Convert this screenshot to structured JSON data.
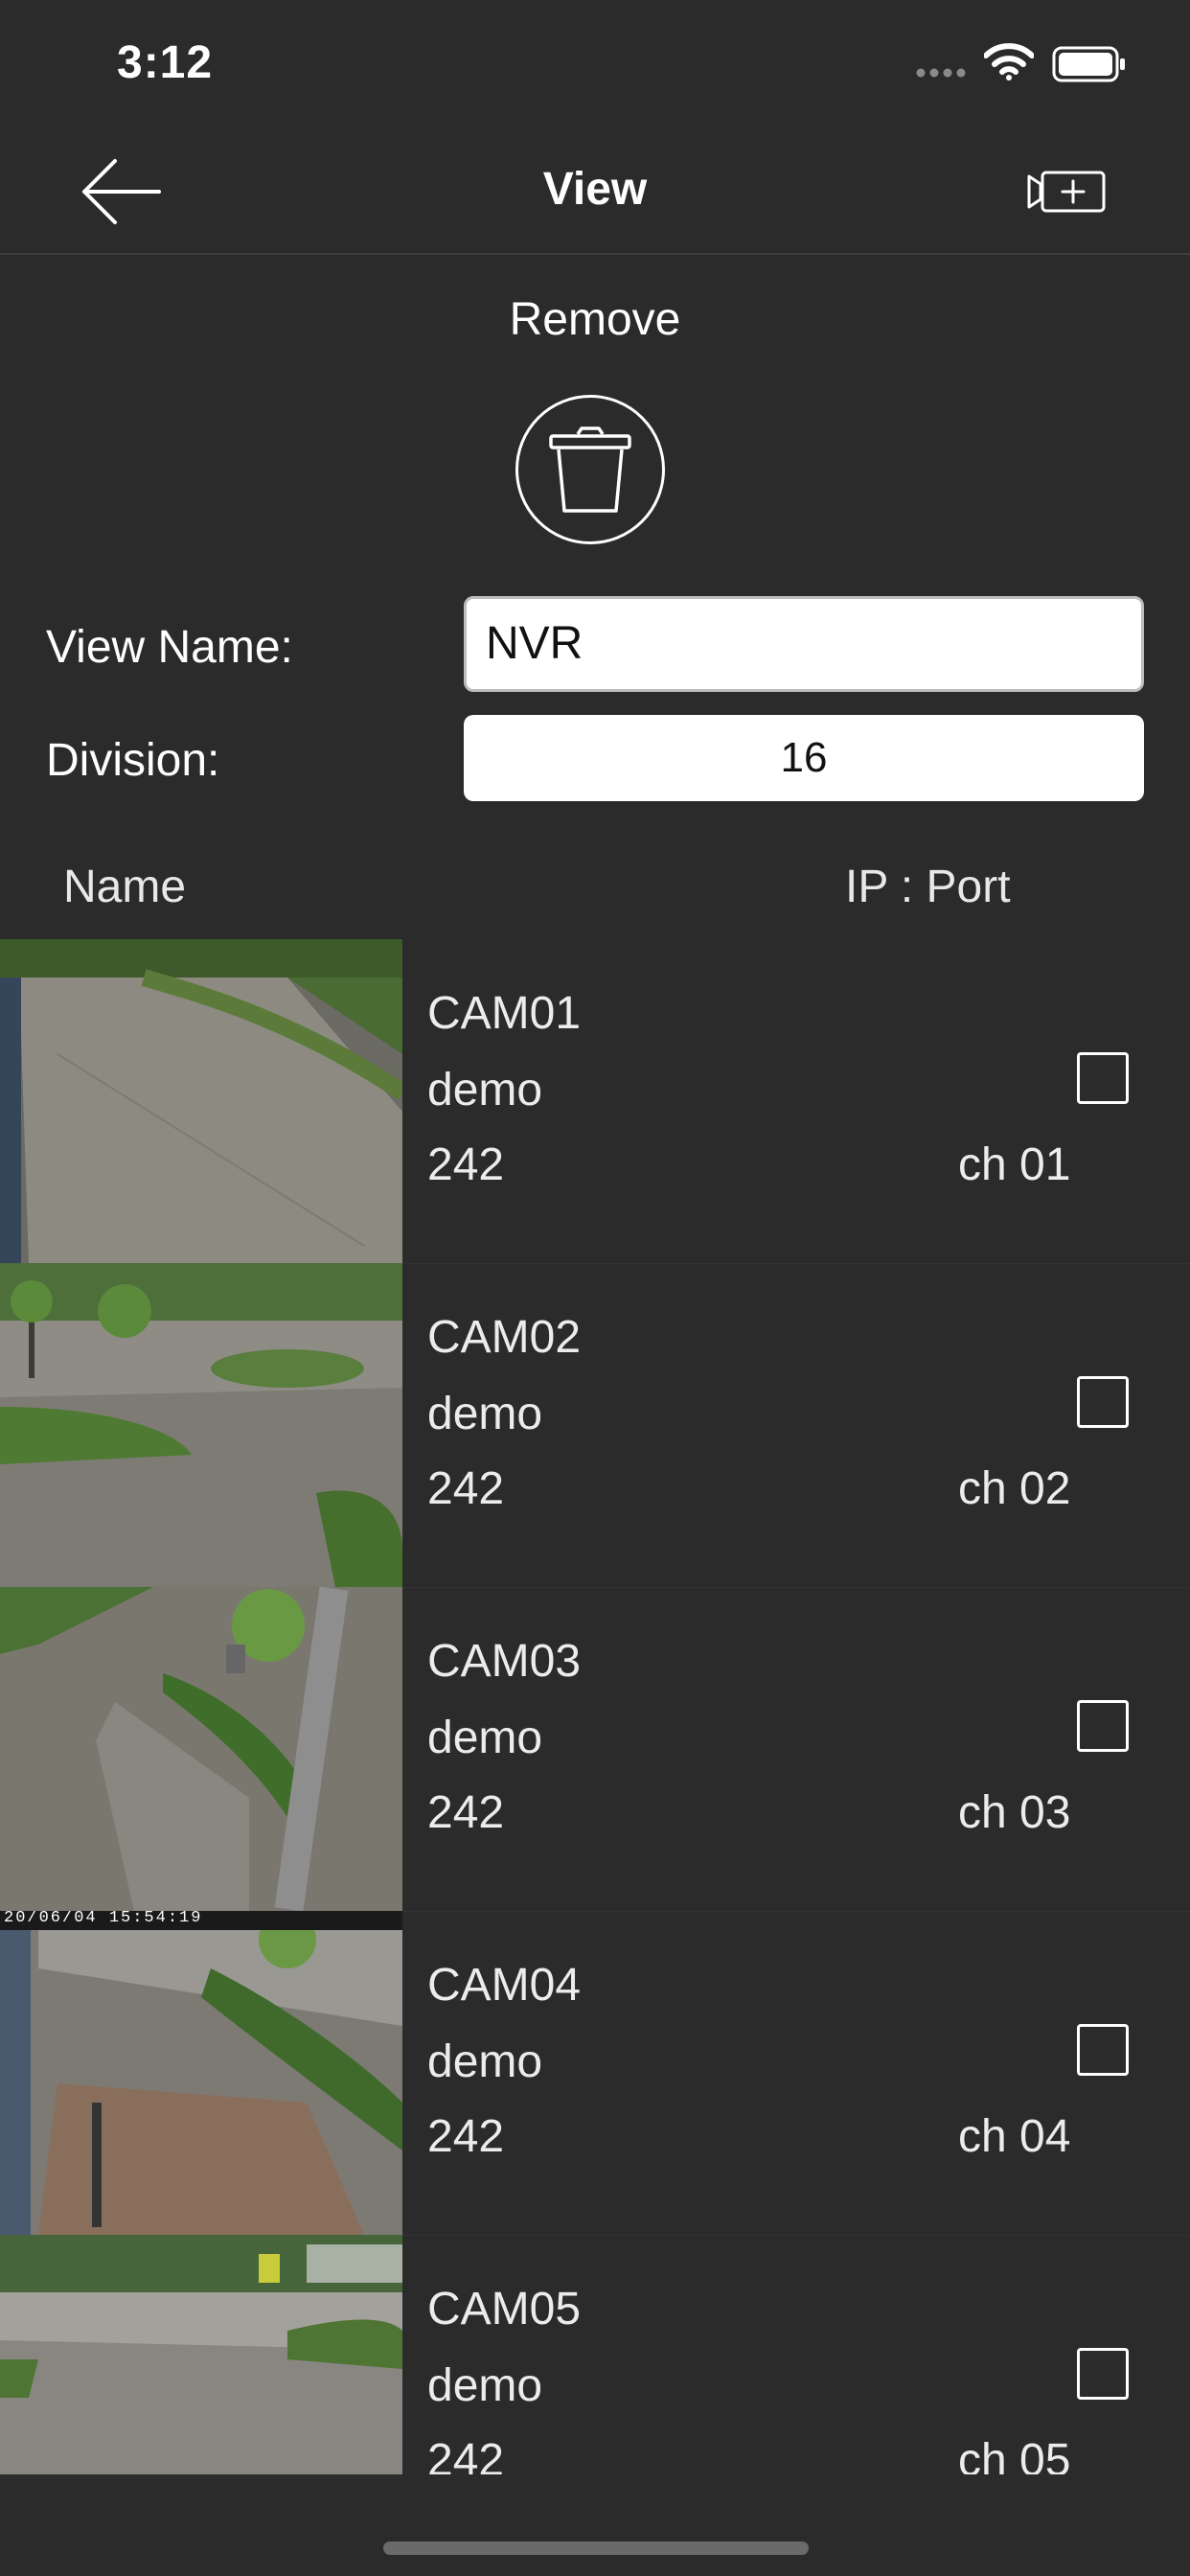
{
  "status_bar": {
    "time": "3:12",
    "icons": [
      "cellular-signal-icon",
      "wifi-icon",
      "battery-icon"
    ]
  },
  "nav": {
    "title": "View",
    "back_icon": "arrow-left-icon",
    "add_camera_icon": "camera-add-icon"
  },
  "remove": {
    "label": "Remove",
    "icon": "trash-icon"
  },
  "form": {
    "view_name_label": "View Name:",
    "view_name_value": "NVR",
    "division_label": "Division:",
    "division_value": "16"
  },
  "table": {
    "headers": {
      "name": "Name",
      "ip_port": "IP : Port"
    },
    "rows": [
      {
        "name": "CAM01",
        "ip": "demo",
        "port": "242",
        "channel": "ch 01",
        "checked": false
      },
      {
        "name": "CAM02",
        "ip": "demo",
        "port": "242",
        "channel": "ch 02",
        "checked": false
      },
      {
        "name": "CAM03",
        "ip": "demo",
        "port": "242",
        "channel": "ch 03",
        "checked": false
      },
      {
        "name": "CAM04",
        "ip": "demo",
        "port": "242",
        "channel": "ch 04",
        "checked": false
      },
      {
        "name": "CAM05",
        "ip": "demo",
        "port": "242",
        "channel": "ch 05",
        "checked": false
      }
    ],
    "thumbnail_overlay_text": "20/06/04 15:54:19"
  },
  "colors": {
    "background": "#2b2b2b",
    "text": "#ffffff",
    "input_background": "#ffffff"
  }
}
